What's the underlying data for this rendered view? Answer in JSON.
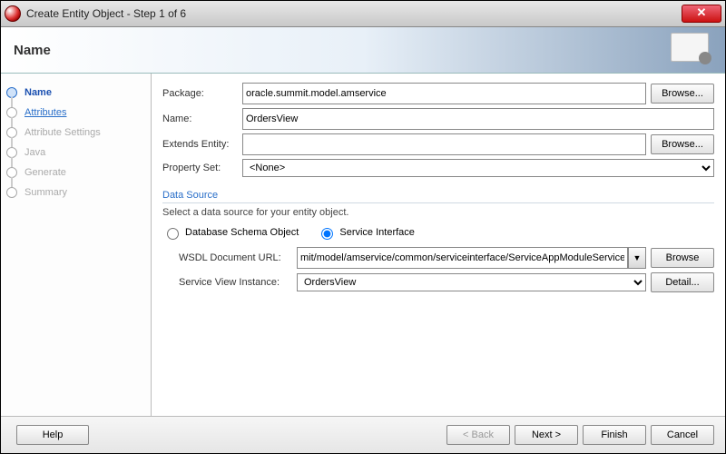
{
  "window": {
    "title": "Create Entity Object - Step 1 of 6"
  },
  "header": {
    "page_title": "Name"
  },
  "sidebar": {
    "steps": [
      {
        "label": "Name",
        "state": "current"
      },
      {
        "label": "Attributes",
        "state": "next"
      },
      {
        "label": "Attribute Settings",
        "state": "future"
      },
      {
        "label": "Java",
        "state": "future"
      },
      {
        "label": "Generate",
        "state": "future"
      },
      {
        "label": "Summary",
        "state": "future"
      }
    ]
  },
  "form": {
    "package_label": "Package:",
    "package_value": "oracle.summit.model.amservice",
    "name_label": "Name:",
    "name_value": "OrdersView",
    "extends_label": "Extends Entity:",
    "extends_value": "",
    "propertyset_label": "Property Set:",
    "propertyset_value": "<None>",
    "browse_label": "Browse..."
  },
  "datasource": {
    "section_label": "Data Source",
    "hint": "Select a data source for your entity object.",
    "radio_db": "Database Schema Object",
    "radio_service": "Service Interface",
    "radio_selected": "service",
    "wsdl_label": "WSDL Document URL:",
    "wsdl_value": "mit/model/amservice/common/serviceinterface/ServiceAppModuleService.wsdl",
    "wsdl_browse": "Browse",
    "svi_label": "Service View Instance:",
    "svi_value": "OrdersView",
    "svi_detail": "Detail..."
  },
  "footer": {
    "help": "Help",
    "back": "< Back",
    "next": "Next >",
    "finish": "Finish",
    "cancel": "Cancel"
  }
}
